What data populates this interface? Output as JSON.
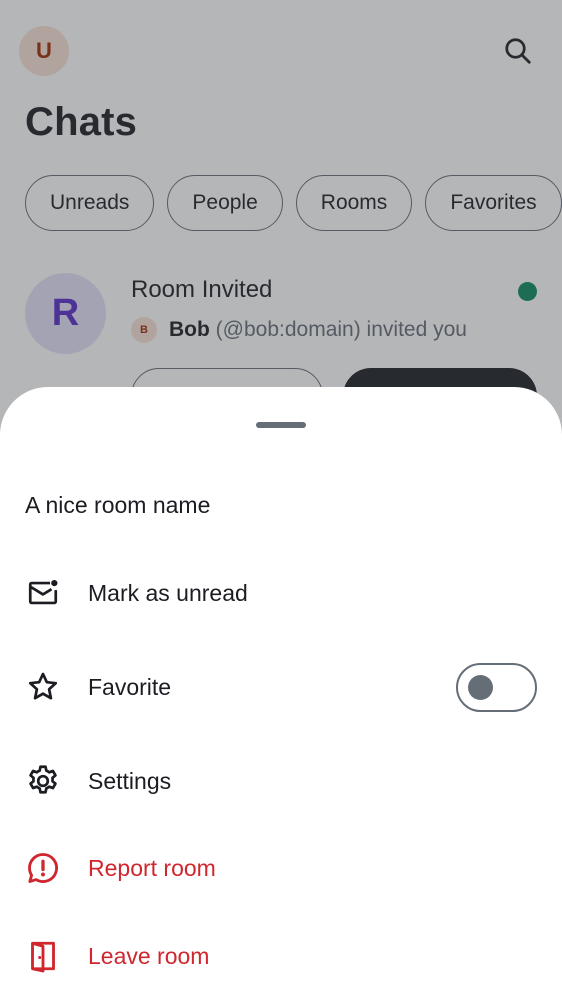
{
  "topbar": {
    "user_avatar_initial": "U",
    "title": "Chats"
  },
  "filters": [
    {
      "label": "Unreads"
    },
    {
      "label": "People"
    },
    {
      "label": "Rooms"
    },
    {
      "label": "Favorites"
    }
  ],
  "room": {
    "avatar_initial": "R",
    "name": "Room Invited",
    "inviter_avatar_initial": "B",
    "inviter_name": "Bob",
    "invite_text": "(@bob:domain) invited you"
  },
  "sheet": {
    "title": "A nice room name",
    "items": [
      {
        "label": "Mark as unread",
        "icon": "mail-unread-icon"
      },
      {
        "label": "Favorite",
        "icon": "star-icon",
        "toggle_on": false
      },
      {
        "label": "Settings",
        "icon": "gear-icon"
      },
      {
        "label": "Report room",
        "icon": "report-icon"
      },
      {
        "label": "Leave room",
        "icon": "leave-door-icon"
      }
    ]
  },
  "colors": {
    "primary_text": "#1b1d22",
    "secondary_text": "#656d77",
    "danger": "#d0262e",
    "unread_dot": "#0a8a5f",
    "room_avatar_bg": "#e3e0f7",
    "room_avatar_fg": "#5a2dc9",
    "user_avatar_bg": "#f9e1d6",
    "user_avatar_fg": "#9b2a00"
  }
}
